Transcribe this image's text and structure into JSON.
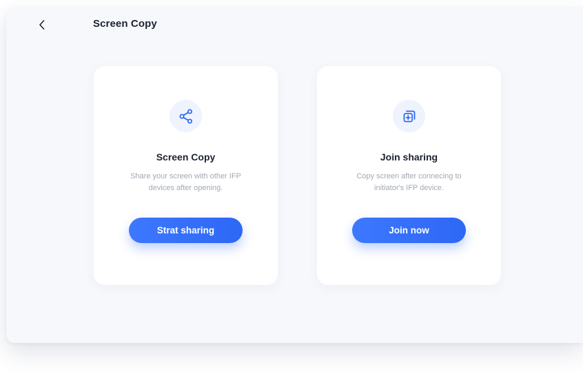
{
  "header": {
    "title": "Screen Copy",
    "back_icon": "chevron-left-icon"
  },
  "cards": [
    {
      "icon": "share-icon",
      "title": "Screen Copy",
      "description": "Share your screen with other IFP devices after opening.",
      "button_label": "Strat sharing"
    },
    {
      "icon": "join-copy-icon",
      "title": "Join sharing",
      "description": "Copy screen after connecing to initiator's IFP device.",
      "button_label": "Join now"
    }
  ],
  "colors": {
    "accent": "#2d67f5",
    "icon_bg": "#eef3fd",
    "background": "#f6f8fb",
    "card": "#ffffff",
    "text_primary": "#1c2230",
    "text_secondary": "#a2a8b3"
  }
}
